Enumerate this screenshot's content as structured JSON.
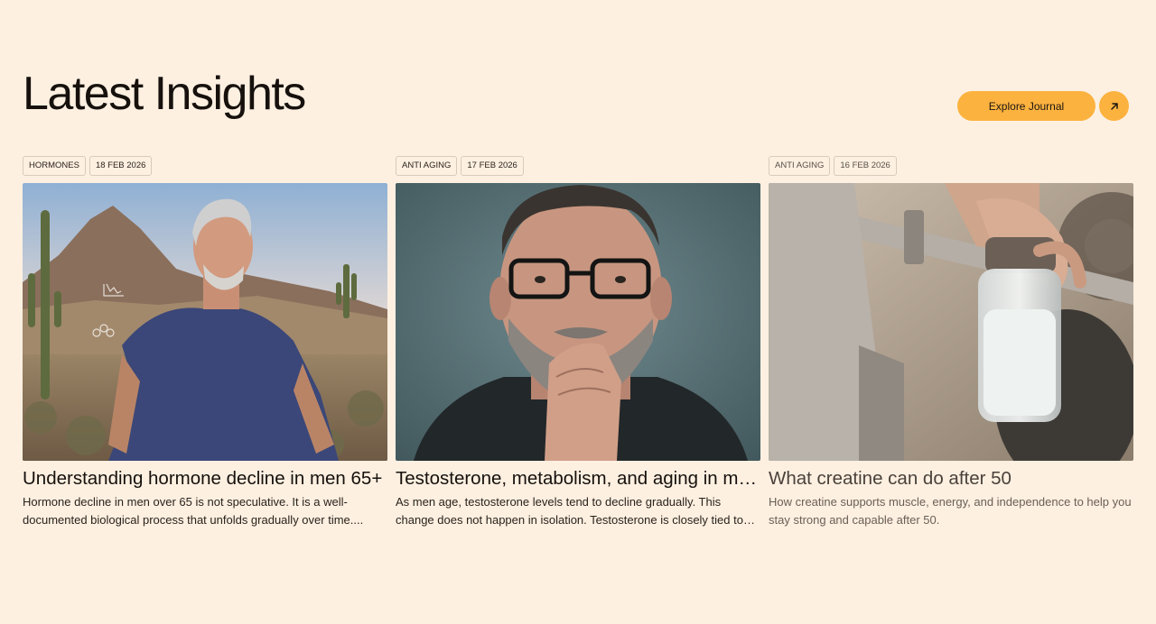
{
  "header": {
    "title": "Latest Insights",
    "explore_label": "Explore Journal",
    "explore_icon": "arrow-up-right-icon"
  },
  "colors": {
    "background": "#fdf0e1",
    "accent": "#fcb23f",
    "text": "#16110d"
  },
  "cards": [
    {
      "category": "HORMONES",
      "date": "18 FEB 2026",
      "title": "Understanding hormone decline in men 65+",
      "excerpt": "Hormone decline in men over 65 is not speculative. It is a well-documented biological process that unfolds gradually over time....",
      "image": "older man with grey hair in navy t-shirt standing in desert with cacti"
    },
    {
      "category": "ANTI AGING",
      "date": "17 FEB 2026",
      "title": "Testosterone, metabolism, and aging in men:...",
      "excerpt": "As men age, testosterone levels tend to decline gradually. This change does not happen in isolation. Testosterone is closely tied to metabolic...",
      "image": "bearded man with black glasses resting chin on hand against teal background"
    },
    {
      "category": "ANTI AGING",
      "date": "16 FEB 2026",
      "title": "What creatine can do after 50",
      "excerpt": "How creatine supports muscle, energy, and independence to help you stay strong and capable after 50.",
      "image": "hand holding a shaker bottle with white drink in a gym"
    }
  ]
}
